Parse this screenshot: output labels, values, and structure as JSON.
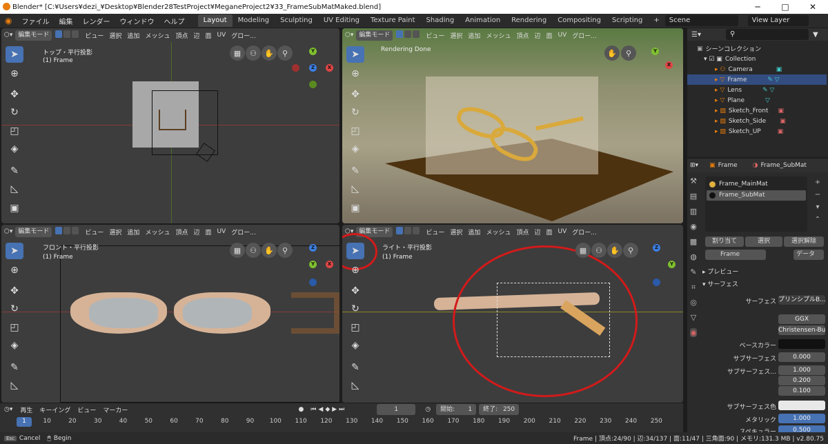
{
  "window": {
    "title": "Blender* [C:¥Users¥dezi_¥Desktop¥Blender28TestProject¥MeganeProject2¥33_FrameSubMatMaked.blend]",
    "min": "─",
    "max": "□",
    "close": "✕"
  },
  "menu": [
    "ファイル",
    "編集",
    "レンダー",
    "ウィンドウ",
    "ヘルプ"
  ],
  "workspaces": [
    "Layout",
    "Modeling",
    "Sculpting",
    "UV Editing",
    "Texture Paint",
    "Shading",
    "Animation",
    "Rendering",
    "Compositing",
    "Scripting",
    "+"
  ],
  "scene": "Scene",
  "viewlayer": "View Layer",
  "vp_header": {
    "mode": "編集モード",
    "items": [
      "ビュー",
      "選択",
      "追加",
      "メッシュ",
      "頂点",
      "辺",
      "面",
      "UV"
    ],
    "global": "グロー..."
  },
  "vp_top": {
    "view": "トップ・平行投影",
    "obj": "(1) Frame"
  },
  "vp_cam": {
    "status": "Rendering Done"
  },
  "vp_front": {
    "view": "フロント・平行投影",
    "obj": "(1) Frame"
  },
  "vp_right": {
    "view": "ライト・平行投影",
    "obj": "(1) Frame"
  },
  "outliner": {
    "root": "シーンコレクション",
    "collection": "Collection",
    "items": [
      "Camera",
      "Frame",
      "Lens",
      "Plane",
      "Sketch_Front",
      "Sketch_Side",
      "Sketch_UP"
    ]
  },
  "props": {
    "obj": "Frame",
    "mat": "Frame_SubMat",
    "slots": [
      "Frame_MainMat",
      "Frame_SubMat"
    ],
    "assign": "割り当て",
    "select": "選択",
    "deselect": "選択解除",
    "matname": "Frame",
    "data": "データ",
    "preview": "プレビュー",
    "surface_panel": "サーフェス",
    "rows": [
      {
        "l": "サーフェス",
        "v": "プリンシプルB..."
      },
      {
        "l": "",
        "v": "GGX"
      },
      {
        "l": "",
        "v": "Christensen-Bu..."
      },
      {
        "l": "ベースカラー",
        "v": ""
      },
      {
        "l": "サブサーフェス",
        "v": "0.000"
      },
      {
        "l": "サブサーフェス...",
        "v": "1.000"
      },
      {
        "l": "",
        "v": "0.200"
      },
      {
        "l": "",
        "v": "0.100"
      },
      {
        "l": "サブサーフェス色",
        "v": ""
      },
      {
        "l": "メタリック",
        "v": "1.000"
      },
      {
        "l": "スペキュラー",
        "v": "0.500"
      }
    ]
  },
  "timeline": {
    "play": "再生",
    "keying": "キーイング",
    "view": "ビュー",
    "marker": "マーカー",
    "frame": "1",
    "start_l": "開始:",
    "start": "1",
    "end_l": "終了:",
    "end": "250",
    "ticks": [
      "1",
      "10",
      "20",
      "30",
      "40",
      "50",
      "60",
      "70",
      "80",
      "90",
      "100",
      "110",
      "120",
      "130",
      "140",
      "150",
      "160",
      "170",
      "180",
      "190",
      "200",
      "210",
      "220",
      "230",
      "240",
      "250"
    ]
  },
  "status": {
    "cancel": "Cancel",
    "begin": "Begin",
    "info": "Frame | 頂点:24/90 | 辺:34/137 | 面:11/47 | 三角面:90 | メモリ:131.3 MB | v2.80.75"
  }
}
